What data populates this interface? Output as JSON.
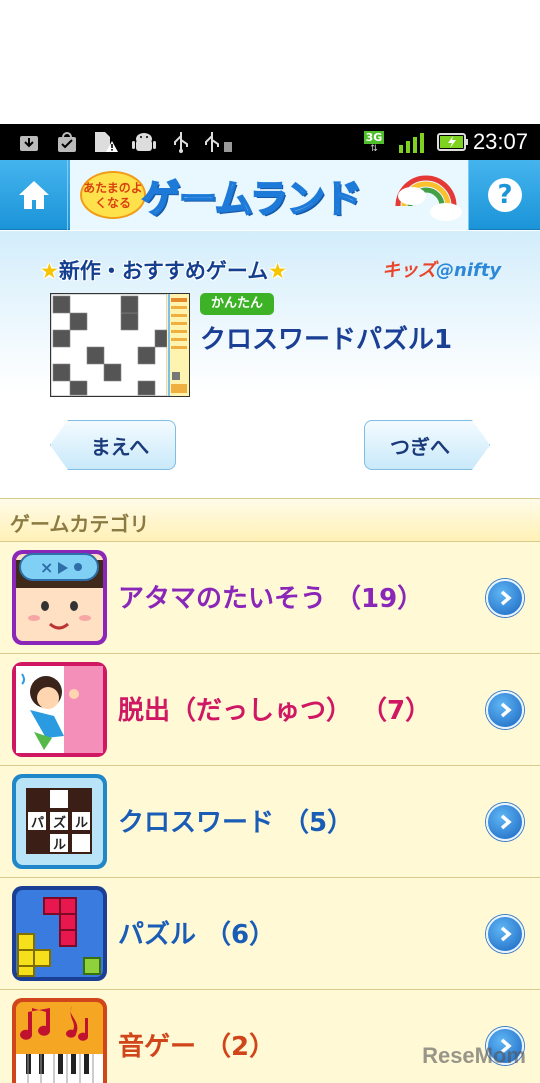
{
  "status_bar": {
    "network": "3G",
    "time": "23:07",
    "icons": [
      "download-icon",
      "bag-check-icon",
      "sim-warning-icon",
      "android-debug-icon",
      "usb-icon",
      "usb-storage-icon",
      "signal-icon",
      "battery-charging-icon"
    ]
  },
  "header": {
    "logo_sub": "あたまのよくなる",
    "logo_title": "ゲームランド",
    "home_icon": "home-icon",
    "help_icon": "help-icon",
    "help_symbol": "?"
  },
  "featured": {
    "heading_star_left": "★",
    "heading_text": "新作・おすすめゲーム",
    "heading_star_right": "★",
    "brand_kids": "キッズ",
    "brand_at": "@",
    "brand_nifty": "nifty",
    "badge": "かんたん",
    "title": "クロスワードパズル1",
    "prev_label": "まえへ",
    "next_label": "つぎへ"
  },
  "categories": {
    "heading": "ゲームカテゴリ",
    "items": [
      {
        "label": "アタマのたいそう （19）",
        "color": "#8a26b8",
        "icon": "brain-exercise-icon"
      },
      {
        "label": "脱出（だっしゅつ） （7）",
        "color": "#d01763",
        "icon": "escape-icon"
      },
      {
        "label": "クロスワード （5）",
        "color": "#1a5db7",
        "icon": "crossword-icon"
      },
      {
        "label": "パズル （6）",
        "color": "#1a5db7",
        "icon": "puzzle-icon"
      },
      {
        "label": "音ゲー （2）",
        "color": "#d0461a",
        "icon": "music-game-icon"
      }
    ]
  },
  "watermark": "ReseMom"
}
